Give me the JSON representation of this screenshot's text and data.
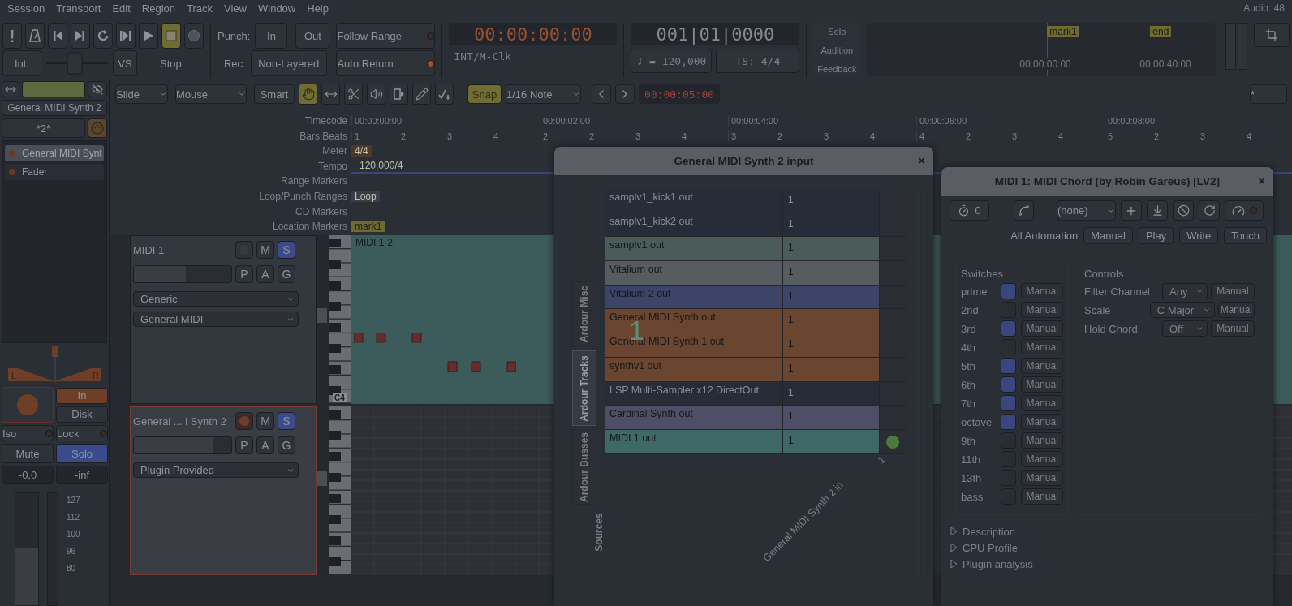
{
  "menu": [
    "Session",
    "Transport",
    "Edit",
    "Region",
    "Track",
    "View",
    "Window",
    "Help"
  ],
  "audio_status": "Audio: 48",
  "transport": {
    "buttons": [
      {
        "kind": "alert",
        "active": false
      },
      {
        "kind": "metronome",
        "active": false
      },
      {
        "kind": "start",
        "active": false
      },
      {
        "kind": "end",
        "active": false
      },
      {
        "kind": "loop",
        "active": false
      },
      {
        "kind": "range",
        "active": false
      },
      {
        "kind": "play",
        "active": false
      },
      {
        "kind": "stop",
        "active": true
      },
      {
        "kind": "record",
        "active": false
      }
    ],
    "int": "Int.",
    "shuttle": {
      "level": 0.45
    },
    "vs": "VS",
    "stop_label": "Stop",
    "punch_label": "Punch:",
    "punch_in": "In",
    "punch_out": "Out",
    "rec_label": "Rec:",
    "rec_mode": "Non-Layered",
    "follow_range": {
      "label": "Follow Range",
      "on": false
    },
    "auto_return": {
      "label": "Auto Return",
      "on": true
    },
    "clock": "00:00:00:00",
    "clock_source": "INT/M-Clk",
    "bbt": "001|01|0000",
    "tempo": "♩ = 120,000",
    "meter": "TS: 4/4",
    "monitor": [
      "Solo",
      "Audition",
      "Feedback"
    ],
    "mini_timeline": {
      "markers": [
        "mark1",
        "end"
      ],
      "times": [
        "00:00:00:00",
        "00:00:40:00"
      ]
    }
  },
  "edit_toolbar": {
    "edit_mode": "Slide",
    "ripple": "Mouse",
    "smart": "Smart",
    "tools": [
      {
        "kind": "grab",
        "selected": true
      },
      {
        "kind": "range",
        "selected": false
      },
      {
        "kind": "cut",
        "selected": false
      },
      {
        "kind": "audition",
        "selected": false
      },
      {
        "kind": "stretch",
        "selected": false
      },
      {
        "kind": "draw",
        "selected": false
      },
      {
        "kind": "content",
        "selected": false
      }
    ],
    "snap": {
      "label": "Snap",
      "on": true
    },
    "grid": "1/16 Note",
    "nudge_clock": "00:00:05:00",
    "zoom_focus": "*"
  },
  "strip": {
    "name": "General MIDI Synth 2",
    "input": "*2*",
    "processors": [
      {
        "name": "General MIDI Synt",
        "selected": true
      },
      {
        "name": "Fader",
        "selected": false
      }
    ],
    "pan_left": "L",
    "pan_right": "R",
    "input_button": {
      "label": "In",
      "on": true
    },
    "disk": "Disk",
    "iso": "Iso",
    "lock": "Lock",
    "mute": {
      "label": "Mute",
      "on": false
    },
    "solo": {
      "label": "Solo",
      "on": true
    },
    "gain": "-0,0",
    "peak": "-inf",
    "scale": [
      "127",
      "112",
      "100",
      "96",
      "80"
    ]
  },
  "rulers": {
    "labels": [
      "Timecode",
      "Bars:Beats",
      "Meter",
      "Tempo",
      "Range Markers",
      "Loop/Punch Ranges",
      "CD Markers",
      "Location Markers"
    ],
    "timecode": [
      "00:00:00:00",
      "00:00:02:00",
      "00:00:04:00",
      "00:00:06:00",
      "00:00:08:00"
    ],
    "bars": [
      {
        "bar": "1",
        "beats": [
          "2",
          "3",
          "4"
        ]
      },
      {
        "bar": "2",
        "beats": [
          "2",
          "3",
          "4"
        ]
      },
      {
        "bar": "3",
        "beats": [
          "2",
          "3",
          "4"
        ]
      },
      {
        "bar": "4",
        "beats": [
          "2",
          "3",
          "4"
        ]
      },
      {
        "bar": "5",
        "beats": [
          "2",
          "3",
          "4"
        ]
      }
    ],
    "meter": "4/4",
    "tempo": "120,000/4",
    "loop": "Loop",
    "location": "mark1"
  },
  "tracks": [
    {
      "name": "MIDI 1",
      "selected": false,
      "record_armed": false,
      "soloed": true,
      "buttons": [
        "M",
        "S",
        "P",
        "A",
        "G"
      ],
      "dropdowns": [
        "Generic",
        "General MIDI"
      ],
      "region": "MIDI 1-2",
      "key_label": "C4"
    },
    {
      "name": "General ... l Synth 2",
      "selected": true,
      "record_armed": true,
      "soloed": true,
      "buttons": [
        "M",
        "S",
        "P",
        "A",
        "G"
      ],
      "dropdowns": [
        "Plugin Provided"
      ]
    }
  ],
  "port_dialog": {
    "title": "General MIDI Synth 2 input",
    "close": "×",
    "drag_count": "1",
    "tabs": [
      {
        "label": "Ardour Misc",
        "selected": false
      },
      {
        "label": "Ardour Tracks",
        "selected": true
      },
      {
        "label": "Ardour Busses",
        "selected": false
      }
    ],
    "sources_label": "Sources",
    "ports": [
      {
        "name": "samplv1_kick1 out",
        "channel": "1",
        "color": "#262c38",
        "connected": false
      },
      {
        "name": "samplv1_kick2 out",
        "channel": "1",
        "color": "#262c38",
        "connected": false
      },
      {
        "name": "samplv1 out",
        "channel": "1",
        "color": "#4b5c58",
        "connected": false
      },
      {
        "name": "Vitalium out",
        "channel": "1",
        "color": "#585b60",
        "connected": false
      },
      {
        "name": "Vitalium 2 out",
        "channel": "1",
        "color": "#3c4568",
        "connected": false
      },
      {
        "name": "General MIDI Synth out",
        "channel": "1",
        "color": "#6a4631",
        "connected": false
      },
      {
        "name": "General MIDI Synth 1 out",
        "channel": "1",
        "color": "#6a4631",
        "connected": false
      },
      {
        "name": "synthv1 out",
        "channel": "1",
        "color": "#6a4631",
        "connected": false
      },
      {
        "name": "LSP Multi-Sampler x12 DirectOut",
        "channel": "1",
        "color": "#272c36",
        "connected": false
      },
      {
        "name": "Cardinal Synth out",
        "channel": "1",
        "color": "#504e66",
        "connected": false
      },
      {
        "name": "MIDI 1 out",
        "channel": "1",
        "color": "#3f6966",
        "connected": true
      }
    ],
    "destination": "General MIDI Synth 2 in",
    "destination_channel": "1"
  },
  "plugin_dialog": {
    "title": "MIDI 1: MIDI Chord (by Robin Gareus) [LV2]",
    "close": "×",
    "latency": "0",
    "preset": "(none)",
    "automation_label": "All Automation",
    "automation_buttons": [
      "Manual",
      "Play",
      "Write",
      "Touch"
    ],
    "switches_title": "Switches",
    "switches": [
      {
        "name": "prime",
        "checked": true,
        "mode": "Manual"
      },
      {
        "name": "2nd",
        "checked": false,
        "mode": "Manual"
      },
      {
        "name": "3rd",
        "checked": true,
        "mode": "Manual"
      },
      {
        "name": "4th",
        "checked": false,
        "mode": "Manual"
      },
      {
        "name": "5th",
        "checked": true,
        "mode": "Manual"
      },
      {
        "name": "6th",
        "checked": true,
        "mode": "Manual"
      },
      {
        "name": "7th",
        "checked": true,
        "mode": "Manual"
      },
      {
        "name": "octave",
        "checked": true,
        "mode": "Manual"
      },
      {
        "name": "9th",
        "checked": false,
        "mode": "Manual"
      },
      {
        "name": "11th",
        "checked": false,
        "mode": "Manual"
      },
      {
        "name": "13th",
        "checked": false,
        "mode": "Manual"
      },
      {
        "name": "bass",
        "checked": false,
        "mode": "Manual"
      }
    ],
    "controls_title": "Controls",
    "controls": [
      {
        "label": "Filter Channel",
        "value": "Any",
        "mode": "Manual"
      },
      {
        "label": "Scale",
        "value": "C Major",
        "mode": "Manual"
      },
      {
        "label": "Hold Chord",
        "value": "Off",
        "mode": "Manual"
      }
    ],
    "sections": [
      {
        "label": "Description",
        "expanded": false
      },
      {
        "label": "CPU Profile",
        "expanded": false
      },
      {
        "label": "Plugin analysis",
        "expanded": false
      }
    ]
  }
}
